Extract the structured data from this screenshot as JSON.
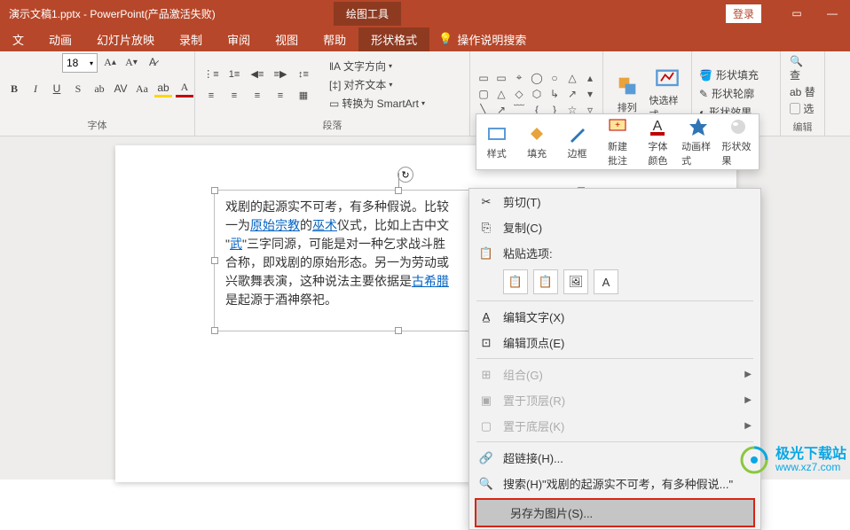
{
  "title": "演示文稿1.pptx - PowerPoint(产品激活失败)",
  "context_tab": "绘图工具",
  "login": "登录",
  "tabs": [
    "文",
    "动画",
    "幻灯片放映",
    "录制",
    "审阅",
    "视图",
    "帮助",
    "形状格式"
  ],
  "tell_me": "操作说明搜索",
  "font": {
    "size": "18",
    "group_label": "字体"
  },
  "para": {
    "group_label": "段落",
    "text_direction": "文字方向",
    "align_text": "对齐文本",
    "convert_smartart": "转换为 SmartArt"
  },
  "arrange": "排列",
  "quick_style": "快选样式",
  "shape_fill": "形状填充",
  "shape_outline": "形状轮廓",
  "shape_effects": "形状效果",
  "edit_find": "查",
  "edit_replace": "替",
  "edit_select": "选",
  "edit_label": "编辑",
  "body": {
    "line1": "戏剧的起源实不可考，有多种假说。比较",
    "line2a": "一为",
    "link1": "原始宗教",
    "line2b": "的",
    "link2": "巫术",
    "line2c": "仪式，比如上古中文",
    "line3a": "\"",
    "link3": "武",
    "line3b": "\"三字同源，可能是对一种乞求战斗胜",
    "line4": "合称，即戏剧的原始形态。另一为劳动或",
    "line5a": "兴歌舞表演，这种说法主要依据是",
    "link4": "古希腊",
    "line6": "是起源于酒神祭祀。"
  },
  "mini": {
    "style": "样式",
    "fill": "填充",
    "border": "边框",
    "new_comment": "新建\n批注",
    "font_color": "字体\n颜色",
    "anim_style": "动画样式",
    "shape_fx": "形状效果"
  },
  "ctx": {
    "cut": "剪切(T)",
    "copy": "复制(C)",
    "paste_label": "粘贴选项:",
    "edit_text": "编辑文字(X)",
    "edit_points": "编辑顶点(E)",
    "group": "组合(G)",
    "bring_front": "置于顶层(R)",
    "send_back": "置于底层(K)",
    "hyperlink": "超链接(H)...",
    "search": "搜索(H)\"戏剧的起源实不可考，有多种假说...\"",
    "save_as_pic": "另存为图片(S)..."
  },
  "watermark": {
    "cn": "极光下载站",
    "url": "www.xz7.com"
  }
}
